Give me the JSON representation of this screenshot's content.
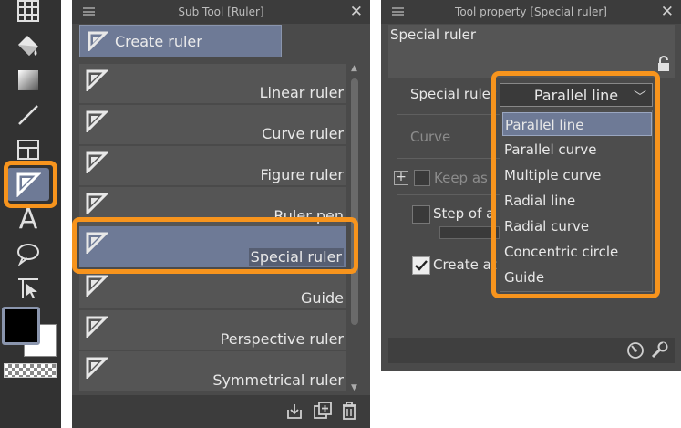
{
  "colors": {
    "accent_orange": "#f7941d",
    "selection": "#6e7a96",
    "panel": "#4a4a4a",
    "titlebar": "#3c3c3c"
  },
  "toolbar": {
    "tools": [
      {
        "name": "grid-tool",
        "icon": "grid-icon"
      },
      {
        "name": "fill-tool",
        "icon": "paint-bucket-icon"
      },
      {
        "name": "gradient-tool",
        "icon": "gradient-square-icon"
      },
      {
        "name": "line-tool",
        "icon": "line-icon"
      },
      {
        "name": "frame-tool",
        "icon": "frame-border-icon"
      },
      {
        "name": "ruler-tool",
        "icon": "ruler-triangle-icon",
        "active": true
      },
      {
        "name": "text-tool",
        "icon": "text-A-icon"
      },
      {
        "name": "balloon-tool",
        "icon": "speech-balloon-icon"
      },
      {
        "name": "correction-tool",
        "icon": "cursor-line-icon"
      }
    ],
    "main_color": "#000000",
    "sub_color": "#ffffff"
  },
  "subtool": {
    "title": "Sub Tool [Ruler]",
    "create_button": "Create ruler",
    "items": [
      {
        "label": "Linear ruler"
      },
      {
        "label": "Curve ruler"
      },
      {
        "label": "Figure ruler"
      },
      {
        "label": "Ruler pen"
      },
      {
        "label": "Special ruler",
        "selected": true
      },
      {
        "label": "Guide"
      },
      {
        "label": "Perspective ruler"
      },
      {
        "label": "Symmetrical ruler"
      }
    ]
  },
  "toolprop": {
    "title": "Tool property [Special ruler]",
    "header": "Special ruler",
    "special_ruler_label": "Special ruler",
    "curve_label": "Curve",
    "keep_label": "Keep as",
    "step_label": "Step of a",
    "create_label": "Create at",
    "selected_value": "Parallel line",
    "options": [
      "Parallel line",
      "Parallel curve",
      "Multiple curve",
      "Radial line",
      "Radial curve",
      "Concentric circle",
      "Guide"
    ]
  }
}
